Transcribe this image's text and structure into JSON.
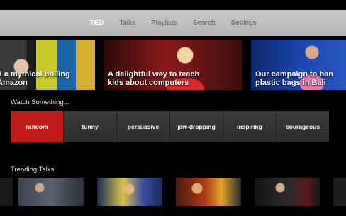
{
  "nav": {
    "items": [
      {
        "label": "TED"
      },
      {
        "label": "Talks"
      },
      {
        "label": "Playlists"
      },
      {
        "label": "Search"
      },
      {
        "label": "Settings"
      }
    ],
    "active": "TED"
  },
  "hero": {
    "cards": [
      {
        "title_line1": "d a mythical boiling",
        "title_line2": "Amazon"
      },
      {
        "title_line1": "A delightful way to teach",
        "title_line2": "kids about computers"
      },
      {
        "title_line1": "Our campaign to ban",
        "title_line2": "plastic bags in Bali"
      }
    ]
  },
  "watch": {
    "label": "Watch Something...",
    "moods": [
      {
        "label": "random"
      },
      {
        "label": "funny"
      },
      {
        "label": "persuasive"
      },
      {
        "label": "jaw-dropping"
      },
      {
        "label": "inspiring"
      },
      {
        "label": "courageous"
      }
    ],
    "selected": "random",
    "selected_color": "#c11b18"
  },
  "trending": {
    "label": "Trending Talks"
  }
}
